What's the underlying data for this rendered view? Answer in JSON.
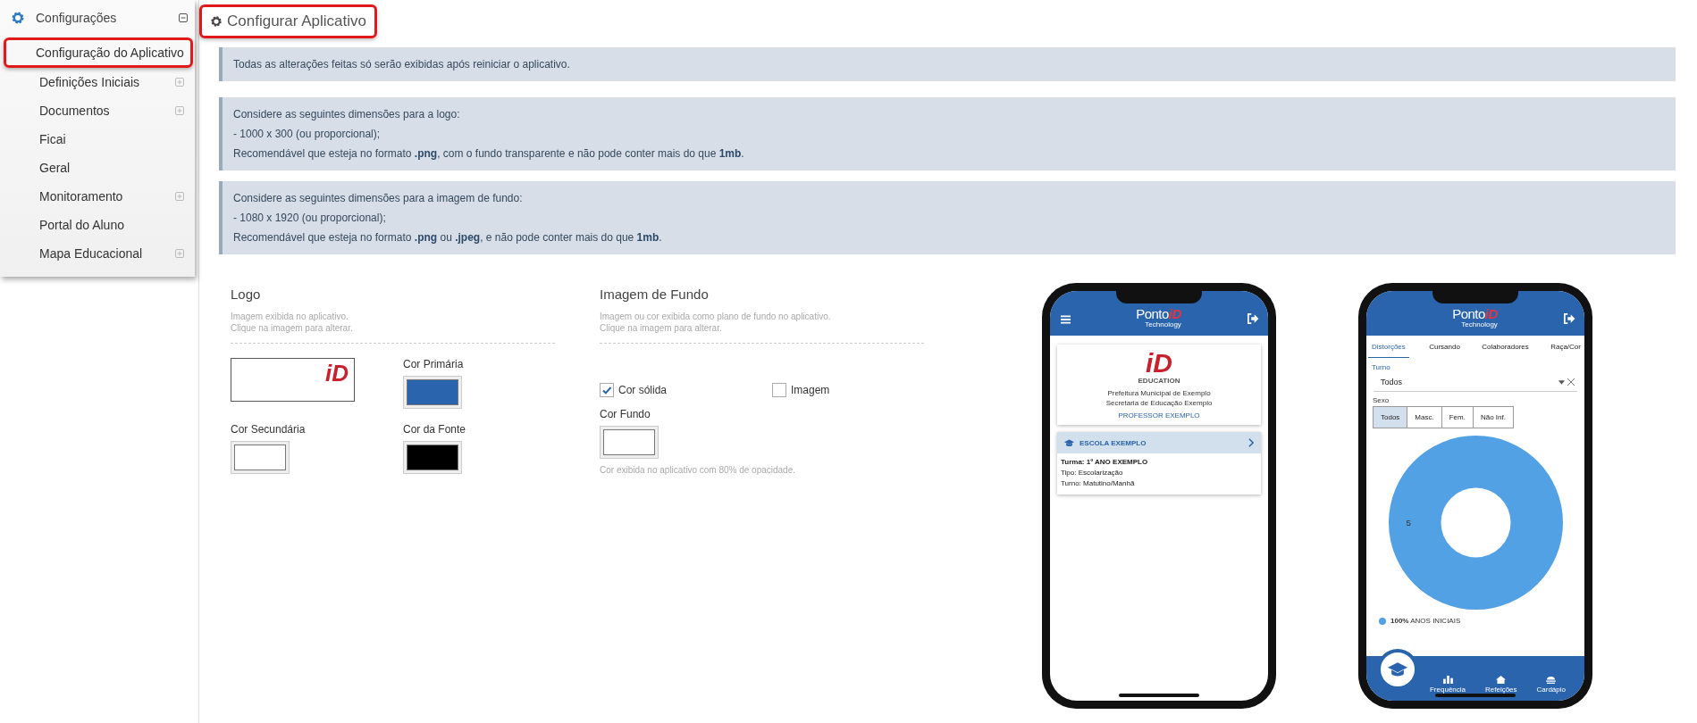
{
  "sidebar": {
    "title": "Configurações",
    "expanded": true,
    "items": [
      {
        "label": "Configuração do Aplicativo",
        "selected": true,
        "expandable": false
      },
      {
        "label": "Definições Iniciais",
        "selected": false,
        "expandable": true
      },
      {
        "label": "Documentos",
        "selected": false,
        "expandable": true
      },
      {
        "label": "Ficai",
        "selected": false,
        "expandable": false
      },
      {
        "label": "Geral",
        "selected": false,
        "expandable": false
      },
      {
        "label": "Monitoramento",
        "selected": false,
        "expandable": true
      },
      {
        "label": "Portal do Aluno",
        "selected": false,
        "expandable": false
      },
      {
        "label": "Mapa Educacional",
        "selected": false,
        "expandable": true
      }
    ]
  },
  "header": {
    "title": "Configurar Aplicativo",
    "highlighted": true
  },
  "notices": [
    {
      "lines": [
        "Todas as alterações feitas só serão exibidas após reiniciar o aplicativo."
      ]
    },
    {
      "lines": [
        "Considere as seguintes dimensões para a logo:",
        "- 1000 x 300 (ou proporcional);",
        "Recomendável que esteja no formato **.png**, com o fundo transparente e não pode conter mais do que **1mb**."
      ]
    },
    {
      "lines": [
        "Considere as seguintes dimensões para a imagem de fundo:",
        "- 1080 x 1920 (ou proporcional);",
        "Recomendável que esteja no formato **.png** ou **.jpeg**, e não pode conter mais do que **1mb**."
      ]
    }
  ],
  "logo_section": {
    "title": "Logo",
    "hint_lines": [
      "Imagem exibida no aplicativo.",
      "Clique na imagem para alterar."
    ],
    "logo_mark": "iD",
    "colors": [
      {
        "label": "Cor Primária",
        "color": "#2a64ad"
      },
      {
        "label": "Cor Secundária",
        "color": "#ffffff"
      },
      {
        "label": "Cor da Fonte",
        "color": "#000000"
      }
    ]
  },
  "background_section": {
    "title": "Imagem de Fundo",
    "hint_lines": [
      "Imagem ou cor exibida como plano de fundo no aplicativo.",
      "Clique na imagem para alterar."
    ],
    "options": [
      {
        "label": "Cor sólida",
        "checked": true
      },
      {
        "label": "Imagem",
        "checked": false
      }
    ],
    "color_label": "Cor Fundo",
    "color": "#ffffff",
    "note": "Cor exibida no aplicativo com 80% de opacidade."
  },
  "previews": [
    {
      "kind": "home",
      "brand": {
        "name": "Ponto",
        "mark": "iD",
        "tagline": "Technology"
      },
      "card": {
        "logo_mark": "iD",
        "logo_word": "EDUCATION",
        "lines": [
          "Prefeitura Municipal de Exemplo",
          "Secretaria de Educação Exemplo"
        ],
        "user": "PROFESSOR EXEMPLO"
      },
      "school": {
        "name": "ESCOLA EXEMPLO",
        "details": [
          {
            "text": "Turma: 1º ANO EXEMPLO",
            "bold": true
          },
          {
            "text": "Tipo: Escolarização",
            "bold": false
          },
          {
            "text": "Turno: Matutino/Manhã",
            "bold": false
          }
        ]
      }
    },
    {
      "kind": "dashboard",
      "brand": {
        "name": "Ponto",
        "mark": "iD",
        "tagline": "Technology"
      },
      "tabs": [
        {
          "label": "Distorções",
          "selected": true
        },
        {
          "label": "Cursando",
          "selected": false
        },
        {
          "label": "Colaboradores",
          "selected": false
        },
        {
          "label": "Raça/Cor",
          "selected": false
        }
      ],
      "filter_label": "Turno",
      "filter_value": "Todos",
      "sex_label": "Sexo",
      "segments": [
        {
          "label": "Todos",
          "selected": true
        },
        {
          "label": "Masc.",
          "selected": false
        },
        {
          "label": "Fem.",
          "selected": false
        },
        {
          "label": "Não Inf.",
          "selected": false
        }
      ],
      "chart_data": {
        "type": "donut",
        "series": [
          {
            "name": "ANOS INICIAIS",
            "color": "#52a1e5",
            "values": [
              5
            ]
          }
        ],
        "data_labels": true
      },
      "legend_percent": "100%",
      "nav": [
        {
          "kind": "bars",
          "label": "Frequência"
        },
        {
          "kind": "house",
          "label": "Refeições"
        },
        {
          "kind": "food",
          "label": "Cardápio"
        }
      ]
    }
  ]
}
